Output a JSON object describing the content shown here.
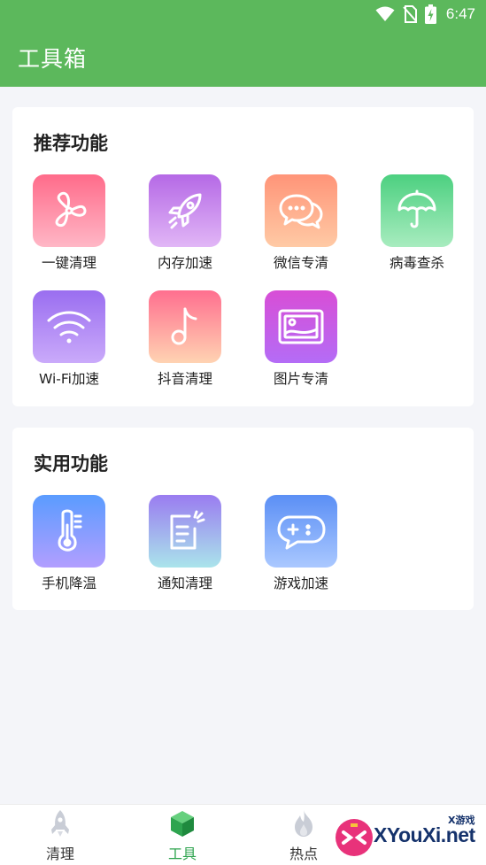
{
  "status_bar": {
    "time": "6:47",
    "icons": [
      "wifi-icon",
      "no-sim-icon",
      "battery-charging-icon"
    ]
  },
  "app_bar": {
    "title": "工具箱"
  },
  "sections": [
    {
      "title": "推荐功能",
      "items": [
        {
          "label": "一键清理",
          "icon": "fan-icon",
          "gradient": [
            "#ff6b8a",
            "#ffb5c5"
          ]
        },
        {
          "label": "内存加速",
          "icon": "rocket-icon",
          "gradient": [
            "#b569e6",
            "#e0b4f5"
          ]
        },
        {
          "label": "微信专清",
          "icon": "chat-bubbles-icon",
          "gradient": [
            "#ff9478",
            "#ffc9a3"
          ]
        },
        {
          "label": "病毒查杀",
          "icon": "umbrella-icon",
          "gradient": [
            "#4cd080",
            "#a5ebbd"
          ]
        },
        {
          "label": "Wi-Fi加速",
          "icon": "wifi-icon",
          "gradient": [
            "#9a6ef0",
            "#c9a9f9"
          ]
        },
        {
          "label": "抖音清理",
          "icon": "music-note-icon",
          "gradient": [
            "#ff6f8f",
            "#ffd1b0"
          ]
        },
        {
          "label": "图片专清",
          "icon": "image-icon",
          "gradient": [
            "#e04fd3",
            "#b36cf5"
          ]
        }
      ]
    },
    {
      "title": "实用功能",
      "items": [
        {
          "label": "手机降温",
          "icon": "thermometer-icon",
          "gradient": [
            "#5a9cff",
            "#b19dff"
          ]
        },
        {
          "label": "通知清理",
          "icon": "notification-note-icon",
          "gradient": [
            "#9a7cf0",
            "#a9e3ea"
          ]
        },
        {
          "label": "游戏加速",
          "icon": "gamepad-icon",
          "gradient": [
            "#5b8ff5",
            "#a9c7ff"
          ]
        }
      ]
    }
  ],
  "tab_bar": {
    "tabs": [
      {
        "label": "清理",
        "icon": "rocket-tab-icon",
        "active": false
      },
      {
        "label": "工具",
        "icon": "cube-tab-icon",
        "active": true
      },
      {
        "label": "热点",
        "icon": "flame-tab-icon",
        "active": false
      }
    ]
  },
  "watermark": {
    "brand": "XYouXi.net",
    "tag": "X游戏"
  },
  "colors": {
    "app_bar": "#5cb85c",
    "background": "#f4f5f9",
    "active_tab": "#2ea44f"
  }
}
